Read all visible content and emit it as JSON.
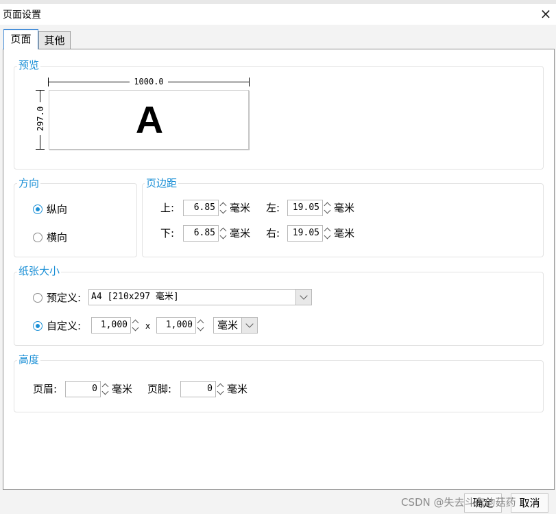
{
  "window": {
    "title": "页面设置",
    "close_icon": "×"
  },
  "tabs": [
    {
      "label": "页面",
      "active": true
    },
    {
      "label": "其他",
      "active": false
    }
  ],
  "preview": {
    "title": "预览",
    "width_label": "1000.0",
    "height_label": "297.0",
    "sample_letter": "A"
  },
  "orientation": {
    "title": "方向",
    "options": [
      {
        "label": "纵向",
        "checked": true
      },
      {
        "label": "横向",
        "checked": false
      }
    ]
  },
  "margins": {
    "title": "页边距",
    "top": {
      "label": "上:",
      "value": "6.85",
      "unit": "毫米"
    },
    "left": {
      "label": "左:",
      "value": "19.05",
      "unit": "毫米"
    },
    "bottom": {
      "label": "下:",
      "value": "6.85",
      "unit": "毫米"
    },
    "right": {
      "label": "右:",
      "value": "19.05",
      "unit": "毫米"
    }
  },
  "paper_size": {
    "title": "纸张大小",
    "predefined": {
      "label": "预定义:",
      "checked": false,
      "value": "A4 [210x297 毫米]"
    },
    "custom": {
      "label": "自定义:",
      "checked": true,
      "width": "1,000",
      "times": "x",
      "height": "1,000",
      "unit": "毫米"
    }
  },
  "height": {
    "title": "高度",
    "header": {
      "label": "页眉:",
      "value": "0",
      "unit": "毫米"
    },
    "footer": {
      "label": "页脚:",
      "value": "0",
      "unit": "毫米"
    }
  },
  "buttons": {
    "ok": "确定",
    "cancel": "取消"
  },
  "watermark": "CSDN @失去斗志的菇药",
  "colors": {
    "accent": "#1a8fd6",
    "group_title": "#1a8fd6"
  }
}
